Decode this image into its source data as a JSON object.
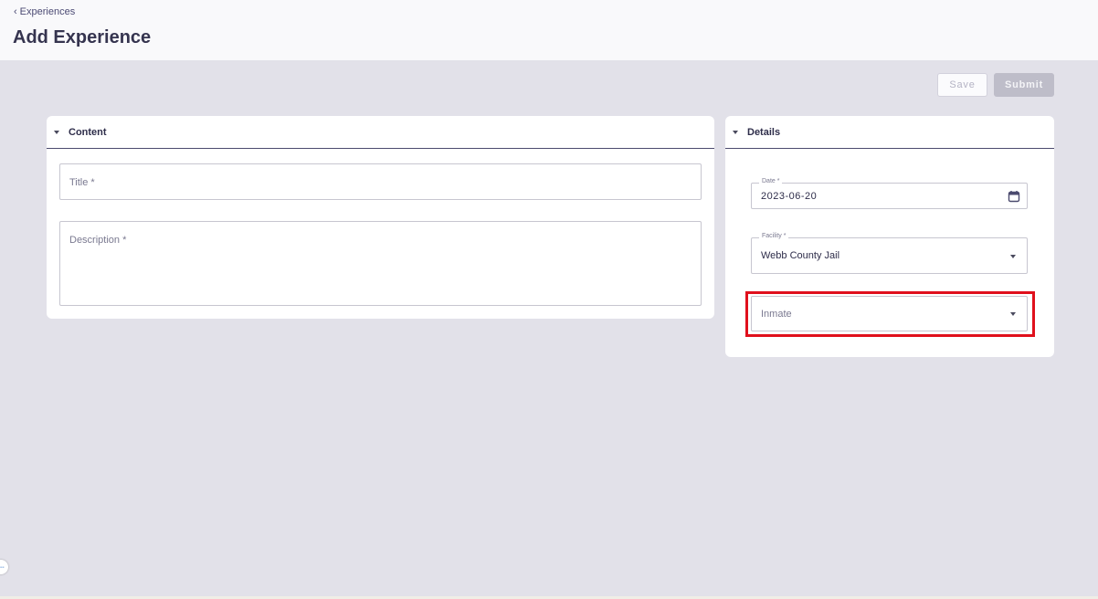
{
  "header": {
    "back_label": "Experiences",
    "title": "Add Experience"
  },
  "actions": {
    "save_label": "Save",
    "submit_label": "Submit"
  },
  "content_panel": {
    "heading": "Content",
    "title_placeholder": "Title *",
    "description_placeholder": "Description *"
  },
  "details_panel": {
    "heading": "Details",
    "date_label": "Date *",
    "date_value": "2023-06-20",
    "facility_label": "Facility *",
    "facility_value": "Webb County Jail",
    "inmate_placeholder": "Inmate"
  },
  "icons": {
    "back": "chevron-left-icon",
    "collapse": "caret-down-icon",
    "calendar": "calendar-icon",
    "dropdown": "caret-down-icon",
    "sidebar_toggle": "arrow-left-icon"
  },
  "colors": {
    "highlight": "#e0101c",
    "background": "#e2e1e9",
    "accent": "#4b4a6e"
  }
}
